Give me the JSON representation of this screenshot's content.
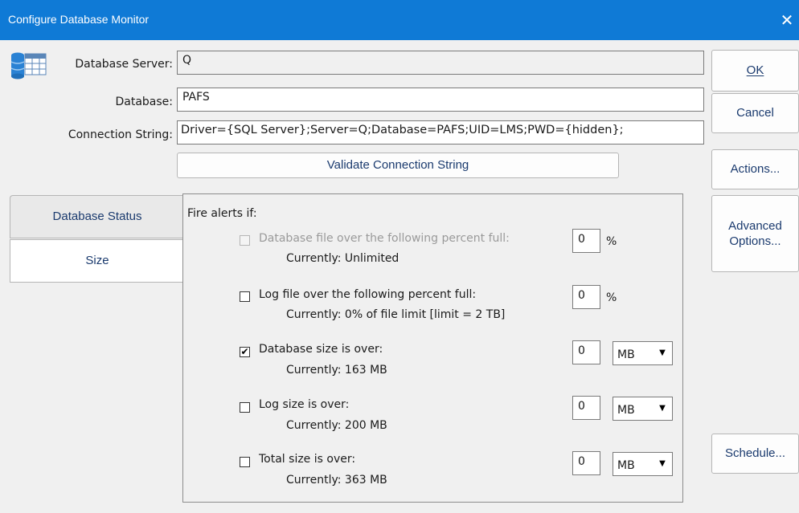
{
  "window": {
    "title": "Configure Database Monitor",
    "close_glyph": "✕"
  },
  "connection": {
    "server_label": "Database Server:",
    "server_value": "Q",
    "database_label": "Database:",
    "database_value": "PAFS",
    "connstr_label": "Connection String:",
    "connstr_value": "Driver={SQL Server};Server=Q;Database=PAFS;UID=LMS;PWD={hidden};",
    "validate_label": "Validate Connection String"
  },
  "buttons": {
    "ok": "OK",
    "cancel": "Cancel",
    "actions": "Actions...",
    "advanced_line1": "Advanced",
    "advanced_line2": "Options...",
    "schedule": "Schedule..."
  },
  "tabs": [
    {
      "label": "Database Status",
      "active": false
    },
    {
      "label": "Size",
      "active": true
    }
  ],
  "panel": {
    "heading": "Fire alerts if:",
    "rows": [
      {
        "label": "Database file over the following percent full:",
        "current": "Currently: Unlimited",
        "checked": false,
        "enabled": false,
        "value": "0",
        "unit": "%"
      },
      {
        "label": "Log file over the following percent full:",
        "current": "Currently: 0% of file limit [limit = 2 TB]",
        "checked": false,
        "enabled": true,
        "value": "0",
        "unit": "%"
      },
      {
        "label": "Database size is over:",
        "current": "Currently: 163 MB",
        "checked": true,
        "enabled": true,
        "value": "0",
        "unit": "MB"
      },
      {
        "label": "Log size is over:",
        "current": "Currently: 200 MB",
        "checked": false,
        "enabled": true,
        "value": "0",
        "unit": "MB"
      },
      {
        "label": "Total size is over:",
        "current": "Currently: 363 MB",
        "checked": false,
        "enabled": true,
        "value": "0",
        "unit": "MB"
      }
    ]
  },
  "colors": {
    "title_bar": "#0f7ad6",
    "link_text": "#1a3a6e"
  },
  "icons": {
    "database": "database-table-icon",
    "dropdown": "chevron-down-icon",
    "check": "check-icon"
  }
}
